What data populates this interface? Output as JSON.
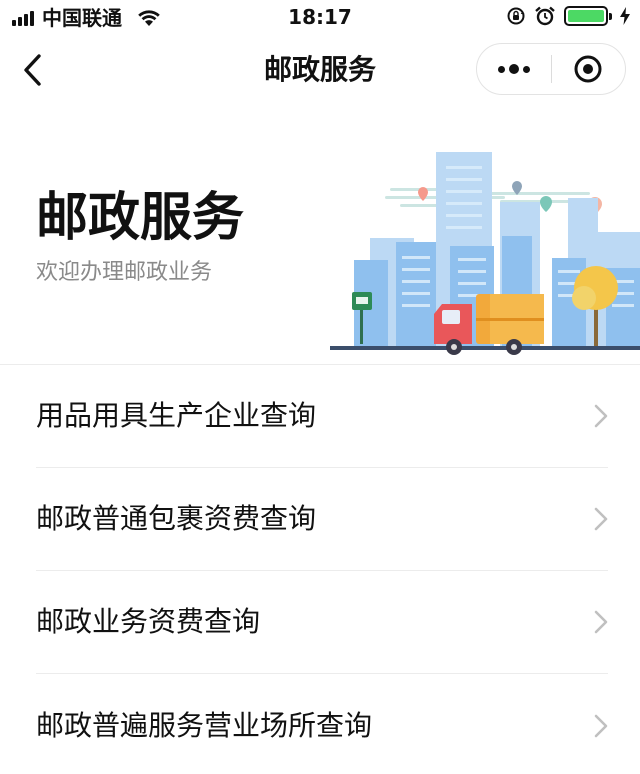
{
  "status_bar": {
    "carrier": "中国联通",
    "time": "18:17",
    "battery_color": "#4cd964",
    "icons": [
      "signal-icon",
      "wifi-icon",
      "orientation-lock-icon",
      "alarm-icon",
      "battery-icon",
      "charging-icon"
    ]
  },
  "nav": {
    "title": "邮政服务",
    "back_icon": "back-arrow-icon",
    "more_icon": "more-dots-icon",
    "close_icon": "target-circle-icon"
  },
  "banner": {
    "title": "邮政服务",
    "subtitle": "欢迎办理邮政业务"
  },
  "menu": {
    "items": [
      {
        "label": "用品用具生产企业查询"
      },
      {
        "label": "邮政普通包裹资费查询"
      },
      {
        "label": "邮政业务资费查询"
      },
      {
        "label": "邮政普遍服务营业场所查询"
      }
    ]
  },
  "colors": {
    "accent_text": "#111111",
    "subtitle": "#8a8a8a",
    "divider": "#ececec",
    "chevron": "#c0c0c0"
  }
}
